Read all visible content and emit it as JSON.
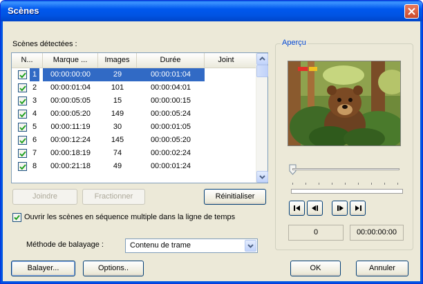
{
  "window": {
    "title": "Scènes"
  },
  "scenes": {
    "label": "Scènes détectées :",
    "columns": [
      "N...",
      "Marque ...",
      "Images",
      "Durée",
      "Joint"
    ],
    "rows": [
      {
        "n": "1",
        "mark": "00:00:00:00",
        "images": "29",
        "duration": "00:00:01:04",
        "checked": true,
        "selected": true
      },
      {
        "n": "2",
        "mark": "00:00:01:04",
        "images": "101",
        "duration": "00:00:04:01",
        "checked": true
      },
      {
        "n": "3",
        "mark": "00:00:05:05",
        "images": "15",
        "duration": "00:00:00:15",
        "checked": true
      },
      {
        "n": "4",
        "mark": "00:00:05:20",
        "images": "149",
        "duration": "00:00:05:24",
        "checked": true
      },
      {
        "n": "5",
        "mark": "00:00:11:19",
        "images": "30",
        "duration": "00:00:01:05",
        "checked": true
      },
      {
        "n": "6",
        "mark": "00:00:12:24",
        "images": "145",
        "duration": "00:00:05:20",
        "checked": true
      },
      {
        "n": "7",
        "mark": "00:00:18:19",
        "images": "74",
        "duration": "00:00:02:24",
        "checked": true
      },
      {
        "n": "8",
        "mark": "00:00:21:18",
        "images": "49",
        "duration": "00:00:01:24",
        "checked": true
      }
    ]
  },
  "buttons": {
    "join": "Joindre",
    "split": "Fractionner",
    "reset": "Réinitialiser",
    "scan": "Balayer...",
    "options": "Options..",
    "ok": "OK",
    "cancel": "Annuler"
  },
  "open_multi": {
    "label": "Ouvrir les scènes en séquence multiple dans la ligne de temps",
    "checked": true
  },
  "scan_method": {
    "label": "Méthode de balayage :",
    "value": "Contenu de trame"
  },
  "preview": {
    "label": "Aperçu",
    "frame": "0",
    "timecode": "00:00:00:00",
    "controls": [
      "go-to-start-icon",
      "step-back-icon",
      "step-forward-icon",
      "go-to-end-icon"
    ]
  },
  "colors": {
    "title_bar": "#0054e3",
    "selection": "#316ac5",
    "group_label": "#0046d5"
  }
}
